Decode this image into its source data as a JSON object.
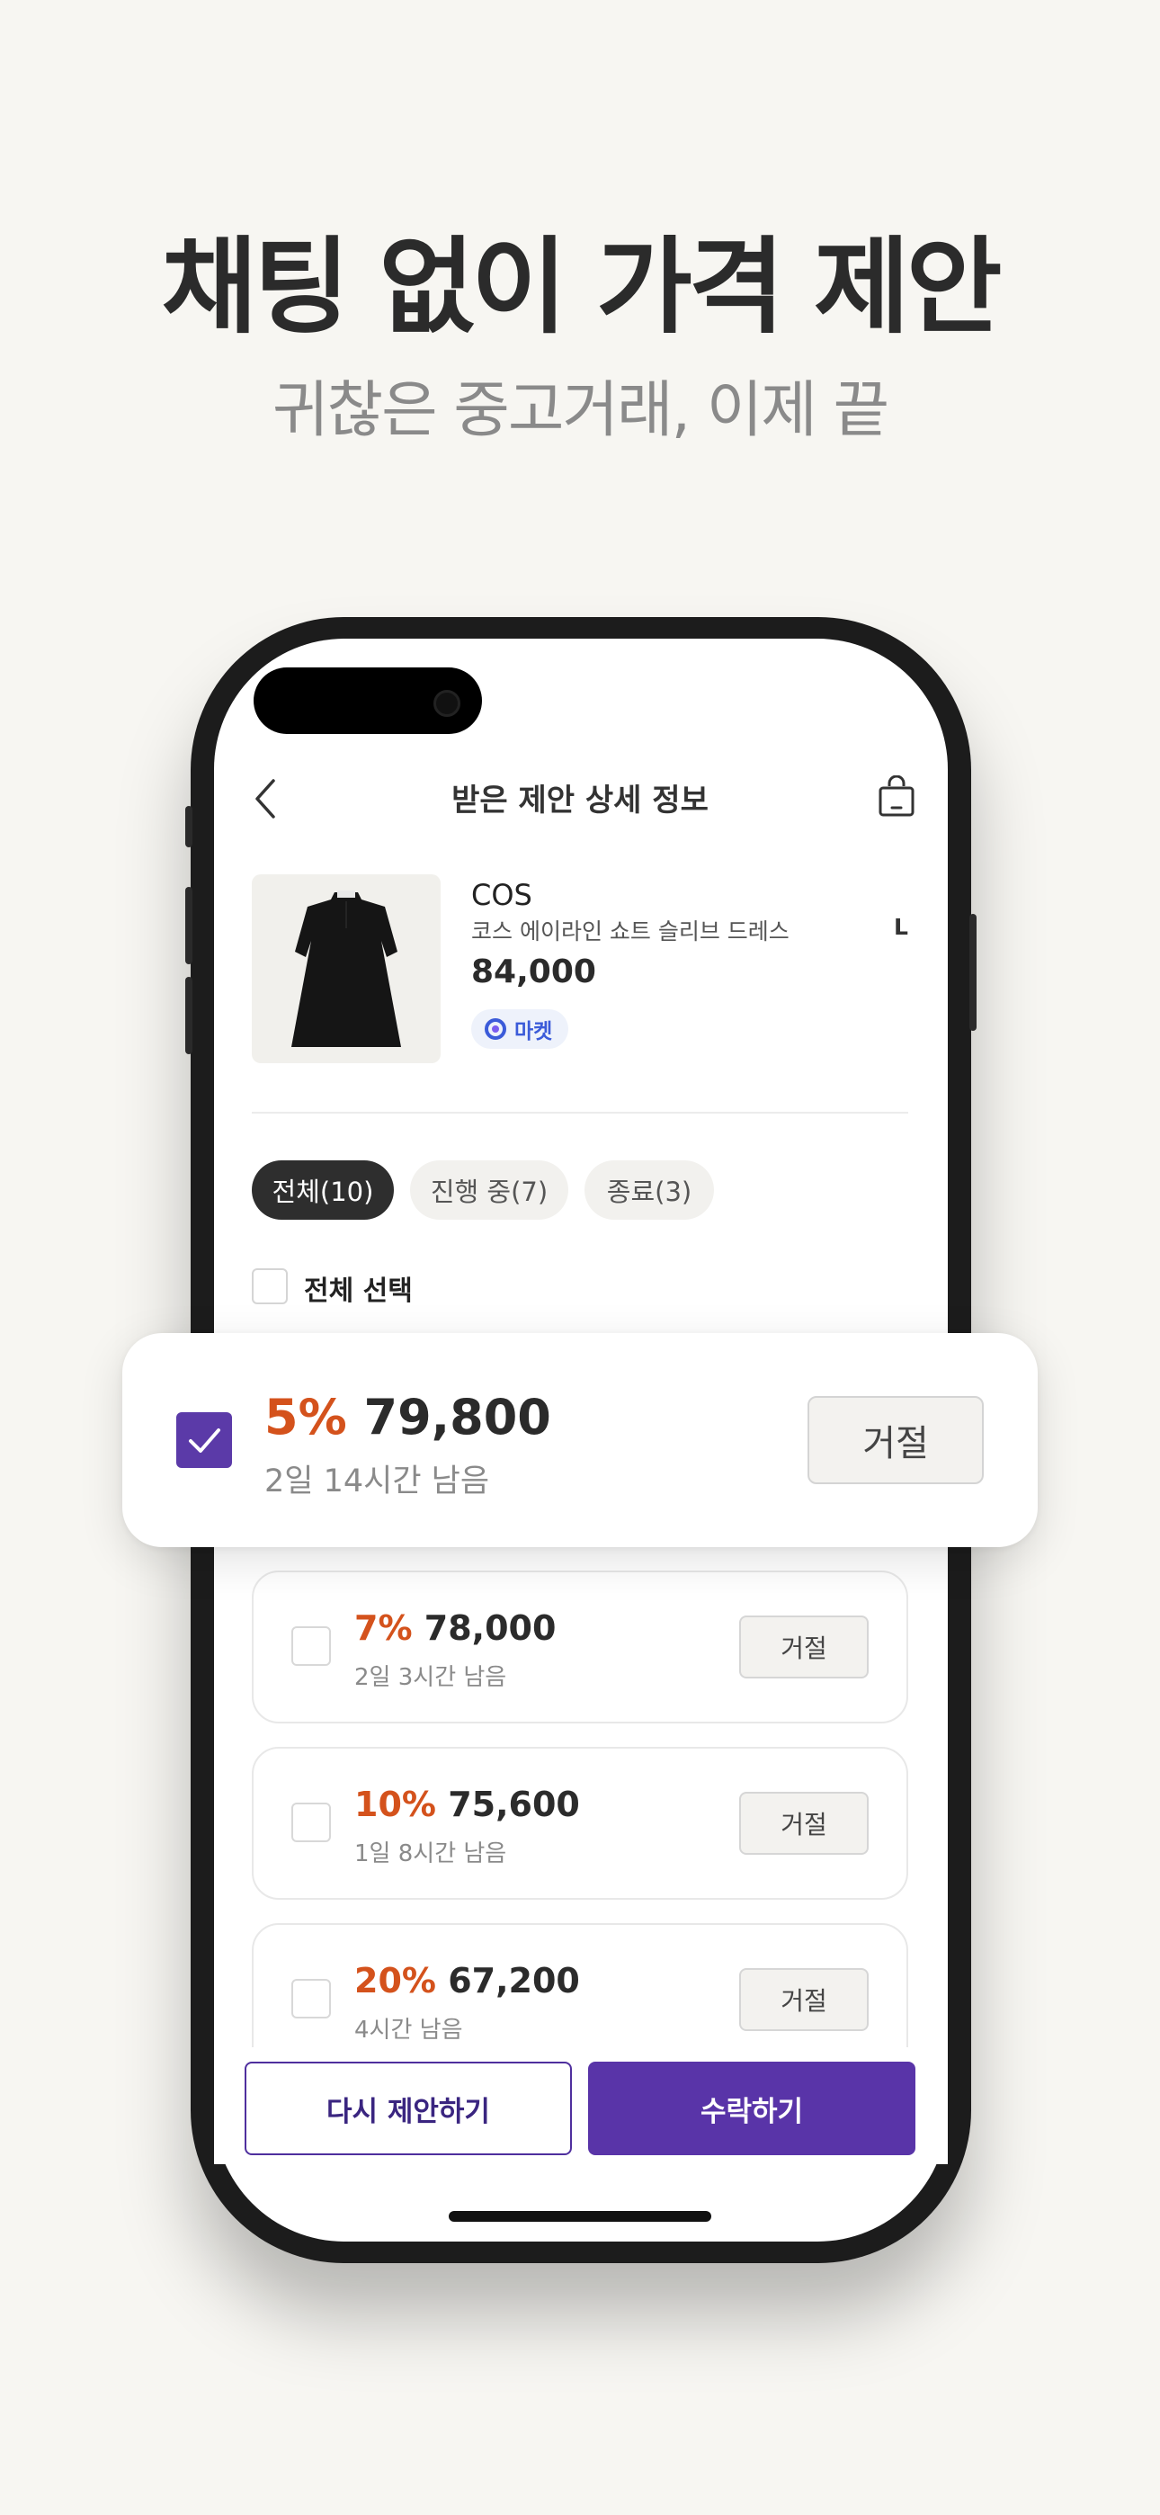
{
  "hero": {
    "title": "채팅 없이 가격 제안",
    "subtitle": "귀찮은 중고거래, 이제 끝"
  },
  "nav": {
    "title": "받은 제안 상세 정보",
    "back_icon": "chevron-left-icon",
    "bag_icon": "shopping-bag-icon"
  },
  "product": {
    "brand": "COS",
    "name": "코스 에이라인 쇼트 슬리브 드레스",
    "size": "L",
    "price": "84,000",
    "badge": "마켓"
  },
  "tabs": [
    {
      "label": "전체(10)",
      "active": true
    },
    {
      "label": "진행 중(7)",
      "active": false
    },
    {
      "label": "종료(3)",
      "active": false
    }
  ],
  "select_all": {
    "label": "전체 선택",
    "checked": false
  },
  "offers": [
    {
      "percent": "5%",
      "amount": "79,800",
      "remaining": "2일 14시간 남음",
      "reject": "거절",
      "checked": true
    },
    {
      "percent": "7%",
      "amount": "78,000",
      "remaining": "2일 3시간 남음",
      "reject": "거절",
      "checked": false
    },
    {
      "percent": "10%",
      "amount": "75,600",
      "remaining": "1일 8시간 남음",
      "reject": "거절",
      "checked": false
    },
    {
      "percent": "20%",
      "amount": "67,200",
      "remaining": "4시간 남음",
      "reject": "거절",
      "checked": false
    }
  ],
  "actions": {
    "counter_offer": "다시 제안하기",
    "accept": "수락하기"
  },
  "colors": {
    "accent": "#5934a8",
    "discount": "#d4521c",
    "background": "#f7f6f2"
  }
}
